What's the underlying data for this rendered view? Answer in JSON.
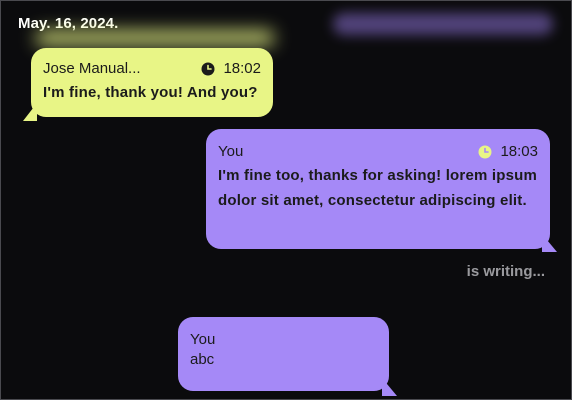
{
  "header": {
    "date": "May. 16, 2024."
  },
  "messages": [
    {
      "sender": "Jose Manual...",
      "time": "18:02",
      "text": "I'm fine, thank you! And you?",
      "bubble_color": "#e8f586",
      "clock_icon": "clock-icon"
    },
    {
      "sender": "You",
      "time": "18:03",
      "text": "I'm fine too, thanks for asking! lorem ipsum dolor sit amet, consectetur adipiscing elit.",
      "bubble_color": "#a589f7",
      "clock_icon": "clock-icon",
      "clock_color": "#e8f586"
    }
  ],
  "typing_indicator": "is writing...",
  "draft": {
    "sender": "You",
    "text": "abc",
    "bubble_color": "#a589f7"
  },
  "colors": {
    "background": "#0b0b0d",
    "lime": "#e8f586",
    "purple": "#a589f7",
    "muted_text": "#9a9a9e"
  }
}
